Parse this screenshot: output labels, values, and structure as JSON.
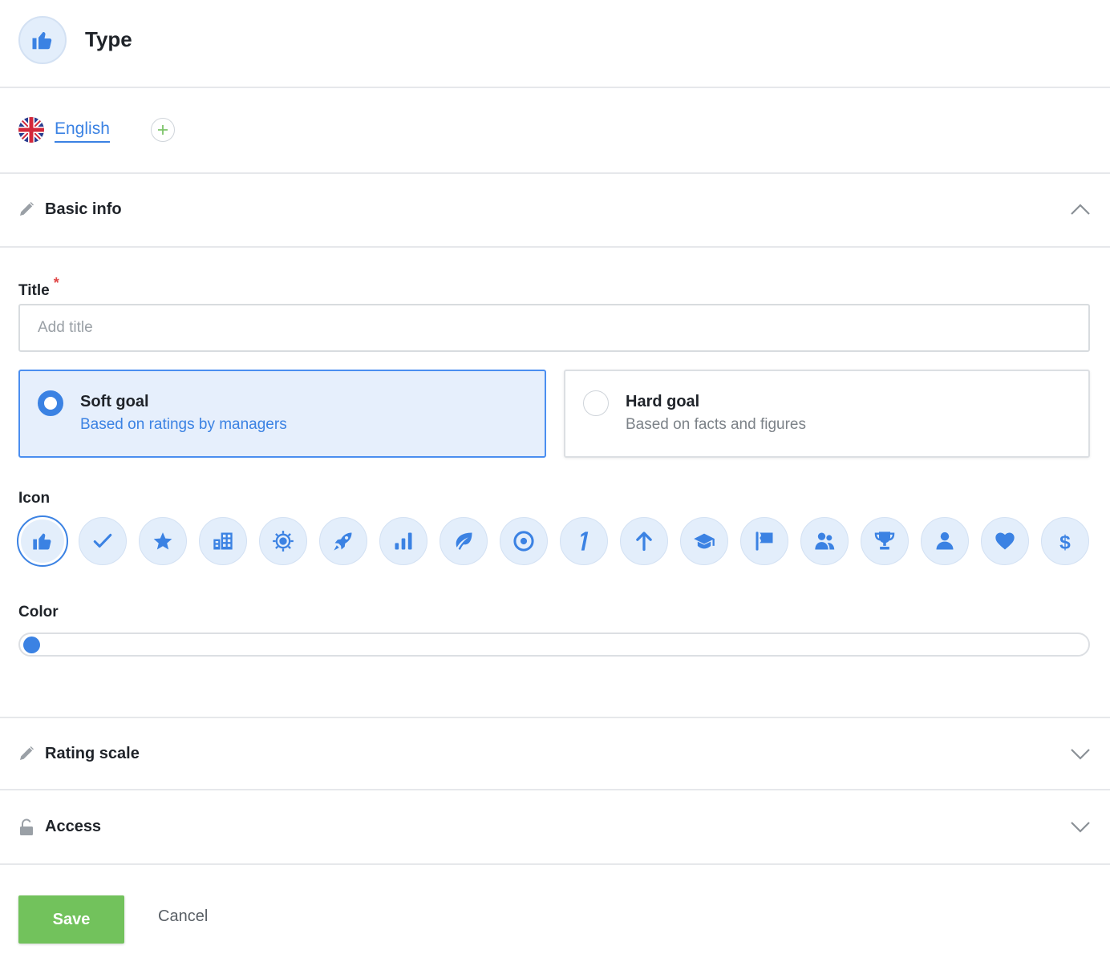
{
  "header": {
    "title": "Type",
    "icon": "thumbs-up-icon"
  },
  "language": {
    "current": "English",
    "flag": "uk-flag-icon",
    "add_icon": "plus-icon"
  },
  "sections": {
    "basic_info": {
      "label": "Basic info",
      "expanded": true
    },
    "rating_scale": {
      "label": "Rating scale",
      "expanded": false
    },
    "access": {
      "label": "Access",
      "expanded": false
    }
  },
  "form": {
    "title_label": "Title",
    "required_mark": "*",
    "title_value": "",
    "title_placeholder": "Add title",
    "goal_types": [
      {
        "title": "Soft goal",
        "subtitle": "Based on ratings by managers",
        "selected": true
      },
      {
        "title": "Hard goal",
        "subtitle": "Based on facts and figures",
        "selected": false
      }
    ],
    "icon_label": "Icon",
    "icons": [
      "thumbs-up",
      "check",
      "star",
      "building",
      "badge",
      "rocket",
      "bar-chart",
      "leaf",
      "target",
      "number-one",
      "arrow-up",
      "graduation-cap",
      "flag",
      "users",
      "trophy",
      "user",
      "heart",
      "dollar"
    ],
    "selected_icon": "thumbs-up",
    "color_label": "Color",
    "selected_color": "#3b82e3"
  },
  "actions": {
    "save_label": "Save",
    "cancel_label": "Cancel"
  },
  "colors": {
    "accent": "#3b82e3",
    "save": "#72c25c",
    "icon_bg": "#e3eefb"
  }
}
